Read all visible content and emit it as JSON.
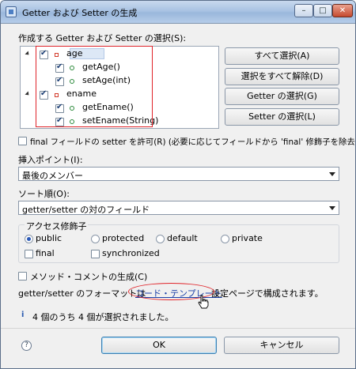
{
  "window": {
    "title": "Getter および Setter の生成",
    "minimize": "–",
    "maximize": "□",
    "close": "✕"
  },
  "section_label": "作成する Getter および Setter の選択(S):",
  "tree": [
    {
      "label": "age",
      "checked": true,
      "kind": "field"
    },
    {
      "label": "getAge()",
      "checked": true,
      "kind": "method"
    },
    {
      "label": "setAge(int)",
      "checked": true,
      "kind": "method"
    },
    {
      "label": "ename",
      "checked": true,
      "kind": "field"
    },
    {
      "label": "getEname()",
      "checked": true,
      "kind": "method"
    },
    {
      "label": "setEname(String)",
      "checked": true,
      "kind": "method"
    }
  ],
  "side_buttons": {
    "select_all": "すべて選択(A)",
    "deselect_all": "選択をすべて解除(D)",
    "select_getters": "Getter の選択(G)",
    "select_setters": "Setter の選択(L)"
  },
  "final_setter_option": "final フィールドの setter を許可(R) (必要に応じてフィールドから 'final' 修飾子を除去)",
  "insertion_point": {
    "label": "挿入ポイント(I):",
    "value": "最後のメンバー"
  },
  "sort_order": {
    "label": "ソート順(O):",
    "value": "getter/setter の対のフィールド"
  },
  "access_modifier": {
    "label": "アクセス修飾子",
    "options": [
      "public",
      "protected",
      "default",
      "private"
    ],
    "selected": "public",
    "final": "final",
    "synchronized": "synchronized"
  },
  "method_comments": "メソッド・コメントの生成(C)",
  "format_text_before": "getter/setter のフォーマットは",
  "format_link": "コード・テンプレート",
  "format_text_after": "設定ページで構成されます。",
  "status": "4 個のうち 4 個が選択されました。",
  "buttons": {
    "ok": "OK",
    "cancel": "キャンセル"
  },
  "help": "?",
  "info_icon": "i",
  "colors": {
    "highlight": "#e0242a",
    "link": "#1a3fa8",
    "titlebar": "#a9c3e3"
  }
}
